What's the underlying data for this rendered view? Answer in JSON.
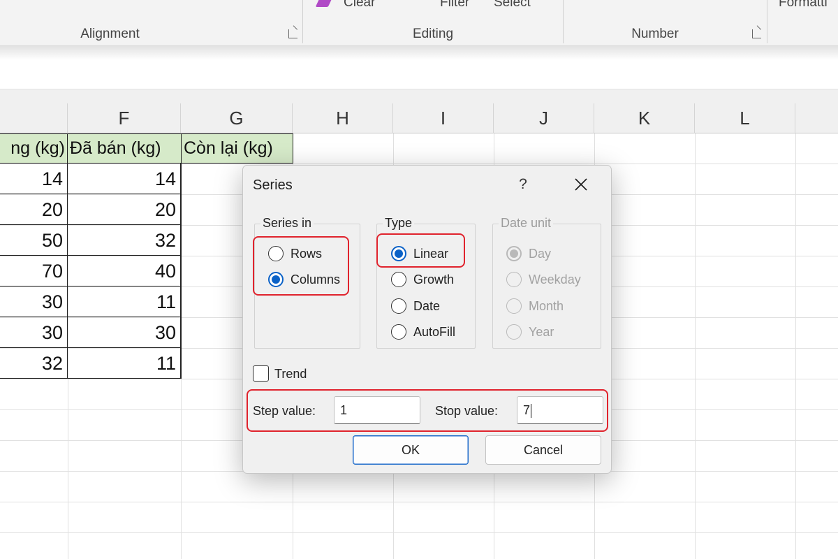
{
  "ribbon": {
    "fragments": {
      "clear": "Clear",
      "filter": "Filter",
      "select": "Select",
      "formatting": "Formatti"
    },
    "groups": {
      "alignment": "Alignment",
      "editing": "Editing",
      "number": "Number"
    }
  },
  "sheet": {
    "columns": [
      "F",
      "G",
      "H",
      "I",
      "J",
      "K",
      "L"
    ],
    "header_cells": {
      "e": "ng (kg)",
      "f": "Đã bán (kg)",
      "g": "Còn lại (kg)"
    },
    "rows": [
      {
        "e": "14",
        "f": "14"
      },
      {
        "e": "20",
        "f": "20"
      },
      {
        "e": "50",
        "f": "32"
      },
      {
        "e": "70",
        "f": "40"
      },
      {
        "e": "30",
        "f": "11"
      },
      {
        "e": "30",
        "f": "30"
      },
      {
        "e": "32",
        "f": "11"
      }
    ]
  },
  "dialog": {
    "title": "Series",
    "help_label": "?",
    "series_in": {
      "label": "Series in",
      "rows": "Rows",
      "columns": "Columns",
      "selected": "Columns"
    },
    "type": {
      "label": "Type",
      "linear": "Linear",
      "growth": "Growth",
      "date": "Date",
      "autofill": "AutoFill",
      "selected": "Linear"
    },
    "date_unit": {
      "label": "Date unit",
      "day": "Day",
      "weekday": "Weekday",
      "month": "Month",
      "year": "Year",
      "selected": "Day"
    },
    "trend": {
      "label": "Trend",
      "checked": false
    },
    "step_value": {
      "label": "Step value:",
      "value": "1"
    },
    "stop_value": {
      "label": "Stop value:",
      "value": "7"
    },
    "ok_label": "OK",
    "cancel_label": "Cancel"
  },
  "colors": {
    "header_fill": "#d6eac9",
    "highlight_red": "#e0232d",
    "radio_blue": "#0b62c7"
  }
}
